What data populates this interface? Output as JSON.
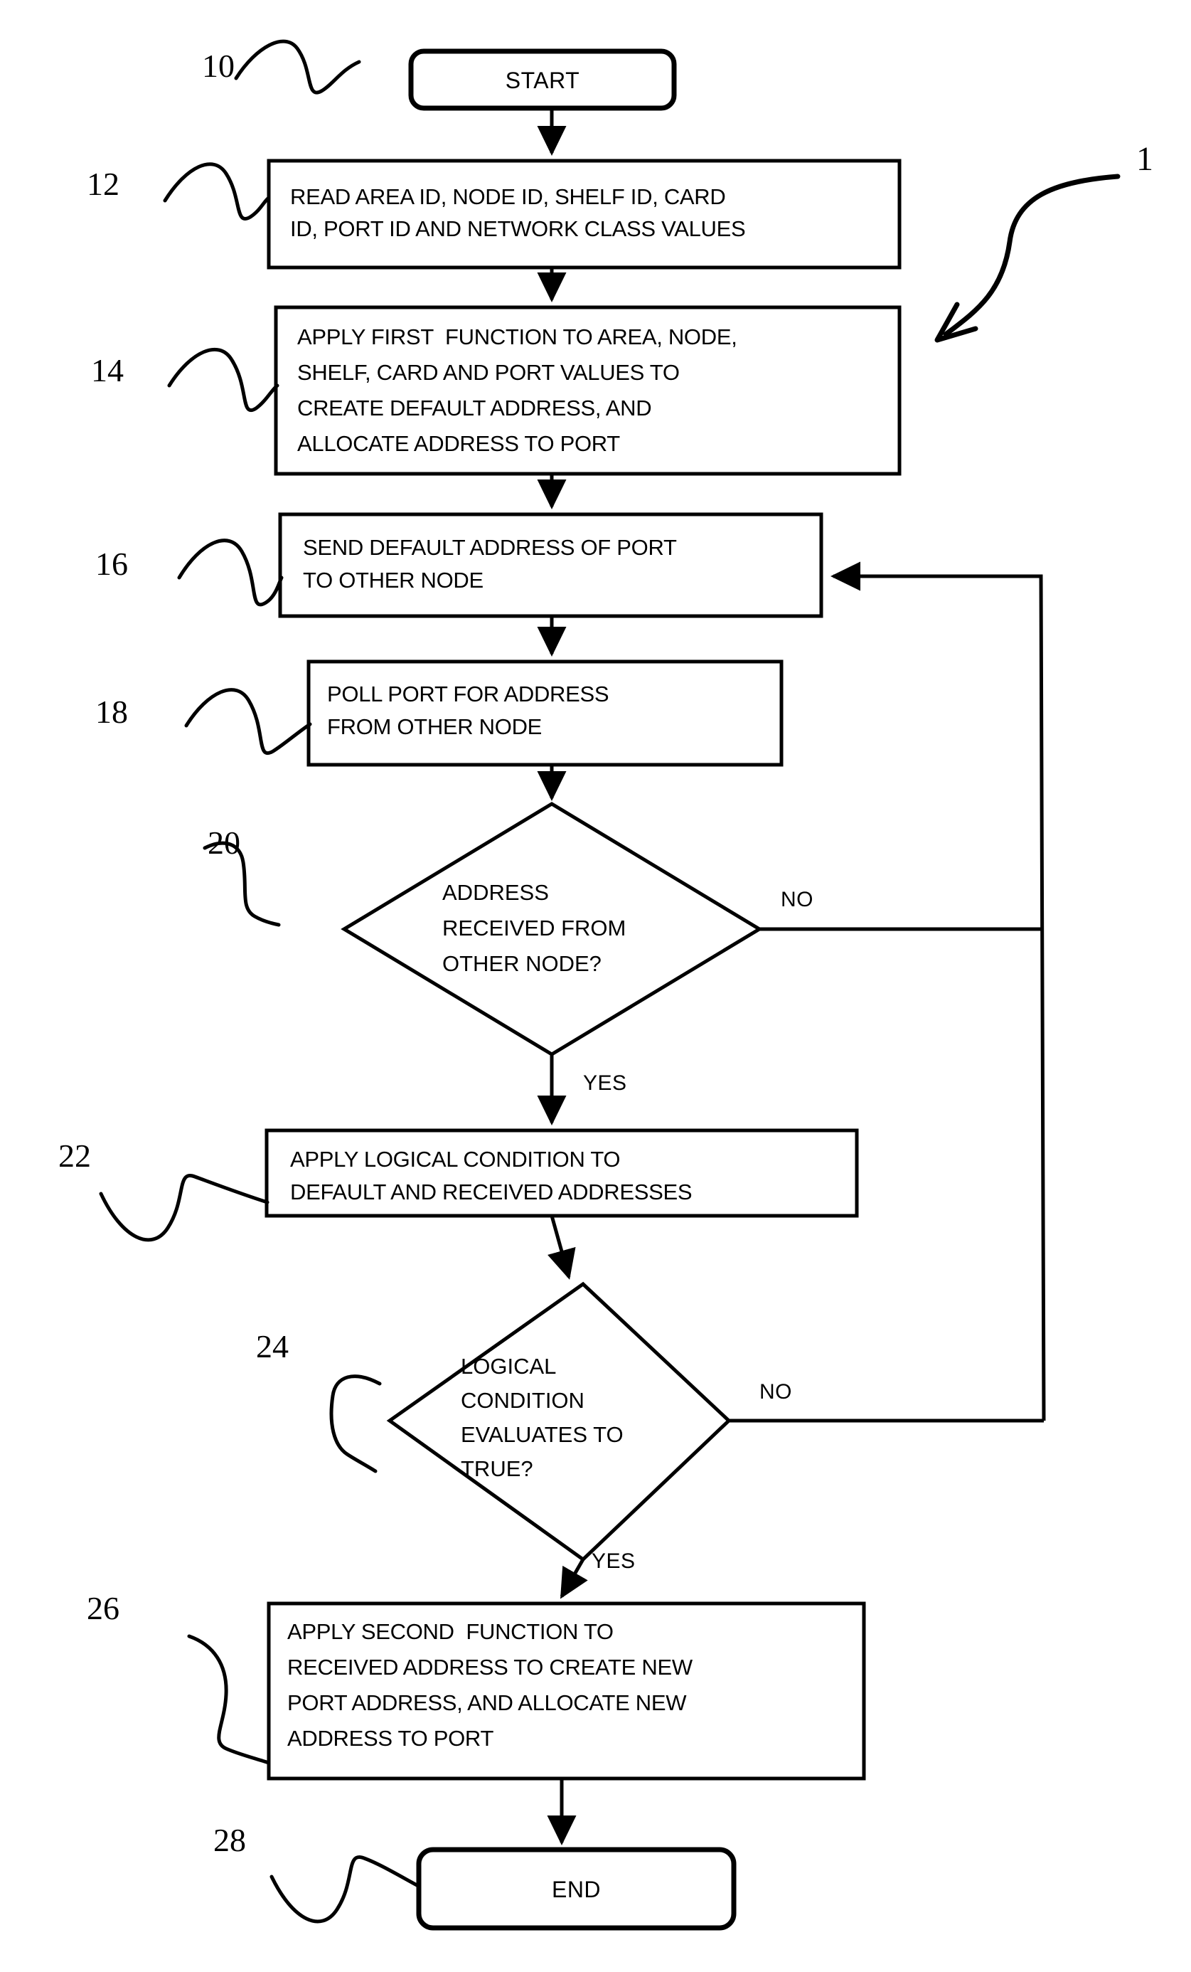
{
  "figure": {
    "label": "1",
    "type": "patent-flowchart"
  },
  "nodes": {
    "start": {
      "ref": "10",
      "label": "START",
      "shape": "rounded-rectangle"
    },
    "read_values": {
      "ref": "12",
      "shape": "rectangle",
      "lines": [
        "READ AREA ID, NODE ID, SHELF ID, CARD",
        "ID, PORT ID AND NETWORK CLASS VALUES"
      ]
    },
    "apply_first_function": {
      "ref": "14",
      "shape": "rectangle",
      "lines": [
        "APPLY FIRST  FUNCTION TO AREA, NODE,",
        "SHELF, CARD AND PORT VALUES TO",
        "CREATE DEFAULT ADDRESS, AND",
        "ALLOCATE ADDRESS TO PORT"
      ]
    },
    "send_default_address": {
      "ref": "16",
      "shape": "rectangle",
      "lines": [
        "SEND DEFAULT ADDRESS OF PORT",
        "TO OTHER NODE"
      ]
    },
    "poll_port": {
      "ref": "18",
      "shape": "rectangle",
      "lines": [
        "POLL PORT FOR ADDRESS",
        "FROM OTHER NODE"
      ]
    },
    "address_received_decision": {
      "ref": "20",
      "shape": "diamond",
      "lines": [
        "ADDRESS",
        "RECEIVED FROM",
        "OTHER NODE?"
      ],
      "yes_label": "YES",
      "no_label": "NO"
    },
    "apply_logical_condition": {
      "ref": "22",
      "shape": "rectangle",
      "lines": [
        "APPLY LOGICAL CONDITION TO",
        "DEFAULT AND RECEIVED ADDRESSES"
      ]
    },
    "condition_true_decision": {
      "ref": "24",
      "shape": "diamond",
      "lines": [
        "LOGICAL",
        "CONDITION",
        "EVALUATES TO",
        "TRUE?"
      ],
      "yes_label": "YES",
      "no_label": "NO"
    },
    "apply_second_function": {
      "ref": "26",
      "shape": "rectangle",
      "lines": [
        "APPLY SECOND  FUNCTION TO",
        "RECEIVED ADDRESS TO CREATE NEW",
        "PORT ADDRESS, AND ALLOCATE NEW",
        "ADDRESS TO PORT"
      ]
    },
    "end": {
      "ref": "28",
      "label": "END",
      "shape": "rounded-rectangle"
    }
  },
  "colors": {
    "stroke": "#000000",
    "fill": "#ffffff",
    "background": "#ffffff"
  }
}
